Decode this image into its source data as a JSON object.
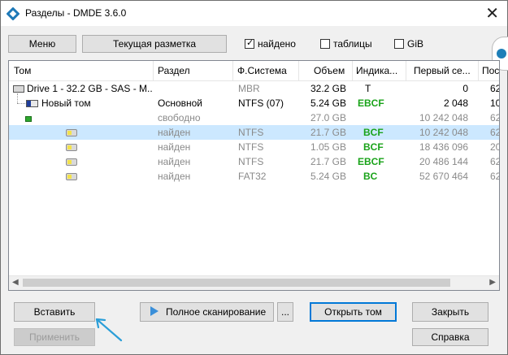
{
  "window": {
    "title": "Разделы - DMDE 3.6.0"
  },
  "toolbar": {
    "menu_label": "Меню",
    "layout_label": "Текущая разметка",
    "found_label": "найдено",
    "found_checked": true,
    "tables_label": "таблицы",
    "tables_checked": false,
    "gib_label": "GiB",
    "gib_checked": false
  },
  "table": {
    "headers": [
      "Том",
      "Раздел",
      "Ф.Система",
      "Объем",
      "Индика...",
      "Первый се...",
      "Пос"
    ],
    "rows": [
      {
        "tom": "Drive 1 - 32.2 GB - SAS - M...",
        "razdel": "",
        "fs": "MBR",
        "size": "32.2 GB",
        "ind": "T",
        "first": "0",
        "last": "62"
      },
      {
        "tom": "Новый том",
        "razdel": "Основной",
        "fs": "NTFS (07)",
        "size": "5.24 GB",
        "ind": "EBCF",
        "first": "2 048",
        "last": "10"
      },
      {
        "tom": "",
        "razdel": "свободно",
        "fs": "",
        "size": "27.0 GB",
        "ind": "",
        "first": "10 242 048",
        "last": "62"
      },
      {
        "tom": "",
        "razdel": "найден",
        "fs": "NTFS",
        "size": "21.7 GB",
        "ind": "BCF",
        "first": "10 242 048",
        "last": "62"
      },
      {
        "tom": "",
        "razdel": "найден",
        "fs": "NTFS",
        "size": "1.05 GB",
        "ind": "BCF",
        "first": "18 436 096",
        "last": "20"
      },
      {
        "tom": "",
        "razdel": "найден",
        "fs": "NTFS",
        "size": "21.7 GB",
        "ind": "EBCF",
        "first": "20 486 144",
        "last": "62"
      },
      {
        "tom": "",
        "razdel": "найден",
        "fs": "FAT32",
        "size": "5.24 GB",
        "ind": "BC",
        "first": "52 670 464",
        "last": "62"
      }
    ]
  },
  "buttons": {
    "insert": "Вставить",
    "apply": "Применить",
    "full_scan": "Полное сканирование",
    "more": "...",
    "open_volume": "Открыть том",
    "close": "Закрыть",
    "help": "Справка"
  },
  "colors": {
    "selection": "#cce8ff",
    "indicator_green": "#1aa31a",
    "accent": "#0078d7"
  }
}
